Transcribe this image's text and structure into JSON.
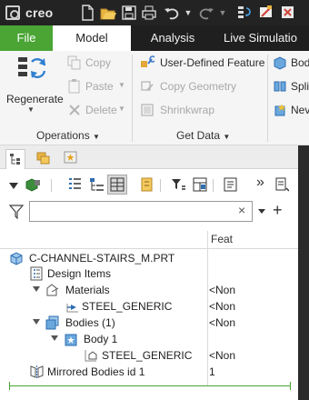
{
  "app": {
    "name": "creo"
  },
  "quick_access": {
    "icons": [
      "new-icon",
      "open-icon",
      "save-icon",
      "print-icon",
      "undo-icon",
      "undo-dropdown-icon",
      "redo-icon",
      "redo-dropdown-icon",
      "regenerate-small-icon",
      "window-icon",
      "close-window-icon"
    ]
  },
  "ribbon_tabs": [
    "File",
    "Model",
    "Analysis",
    "Live Simulatio"
  ],
  "ribbon": {
    "regenerate_label": "Regenerate",
    "copy_label": "Copy",
    "paste_label": "Paste",
    "delete_label": "Delete",
    "operations_label": "Operations",
    "udf_label": "User-Defined Feature",
    "copy_geometry_label": "Copy Geometry",
    "shrinkwrap_label": "Shrinkwrap",
    "get_data_label": "Get Data",
    "body_label": "Bod",
    "split_label": "Spli",
    "new_label": "Nev"
  },
  "tree": {
    "search_placeholder": "",
    "column_header": "Feat",
    "rows": [
      {
        "label": "C-CHANNEL-STAIRS_M.PRT",
        "value": ""
      },
      {
        "label": "Design Items",
        "value": ""
      },
      {
        "label": "Materials",
        "value": "<Non"
      },
      {
        "label": "STEEL_GENERIC",
        "value": "<Non"
      },
      {
        "label": "Bodies (1)",
        "value": "<Non"
      },
      {
        "label": "Body 1",
        "value": ""
      },
      {
        "label": "STEEL_GENERIC",
        "value": "<Non"
      },
      {
        "label": "Mirrored Bodies id 1",
        "value": "1"
      }
    ]
  },
  "colors": {
    "accent_green": "#4aa534",
    "titlebar": "#232323",
    "tab_bar": "#1f1f1f"
  }
}
